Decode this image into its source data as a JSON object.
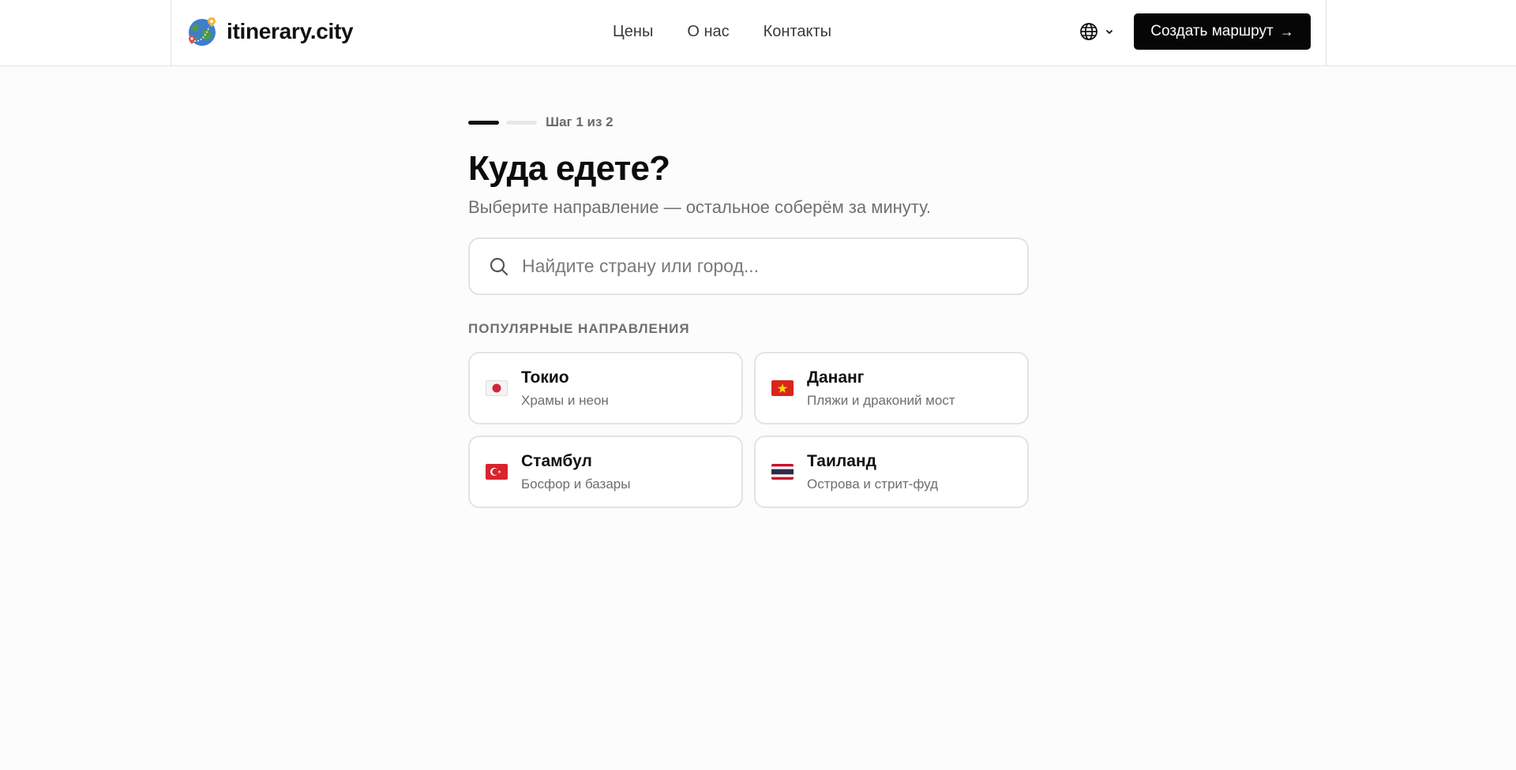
{
  "header": {
    "logo_text": "itinerary.city",
    "nav": [
      "Цены",
      "О нас",
      "Контакты"
    ],
    "cta_label": "Создать маршрут",
    "cta_arrow": "→"
  },
  "wizard": {
    "step_text": "Шаг 1 из 2",
    "title": "Куда едете?",
    "subtitle": "Выберите направление — остальное соберём за минуту."
  },
  "search": {
    "placeholder": "Найдите страну или город..."
  },
  "popular": {
    "label": "ПОПУЛЯРНЫЕ НАПРАВЛЕНИЯ",
    "items": [
      {
        "title": "Токио",
        "subtitle": "Храмы и неон",
        "flag": "japan-flag"
      },
      {
        "title": "Дананг",
        "subtitle": "Пляжи и драконий мост",
        "flag": "vietnam-flag"
      },
      {
        "title": "Стамбул",
        "subtitle": "Босфор и базары",
        "flag": "turkey-flag"
      },
      {
        "title": "Таиланд",
        "subtitle": "Острова и стрит-фуд",
        "flag": "thailand-flag"
      }
    ]
  },
  "colors": {
    "accent": "#060606",
    "border": "#e2e2e2",
    "muted": "#707070",
    "background": "#fdfcfc"
  }
}
